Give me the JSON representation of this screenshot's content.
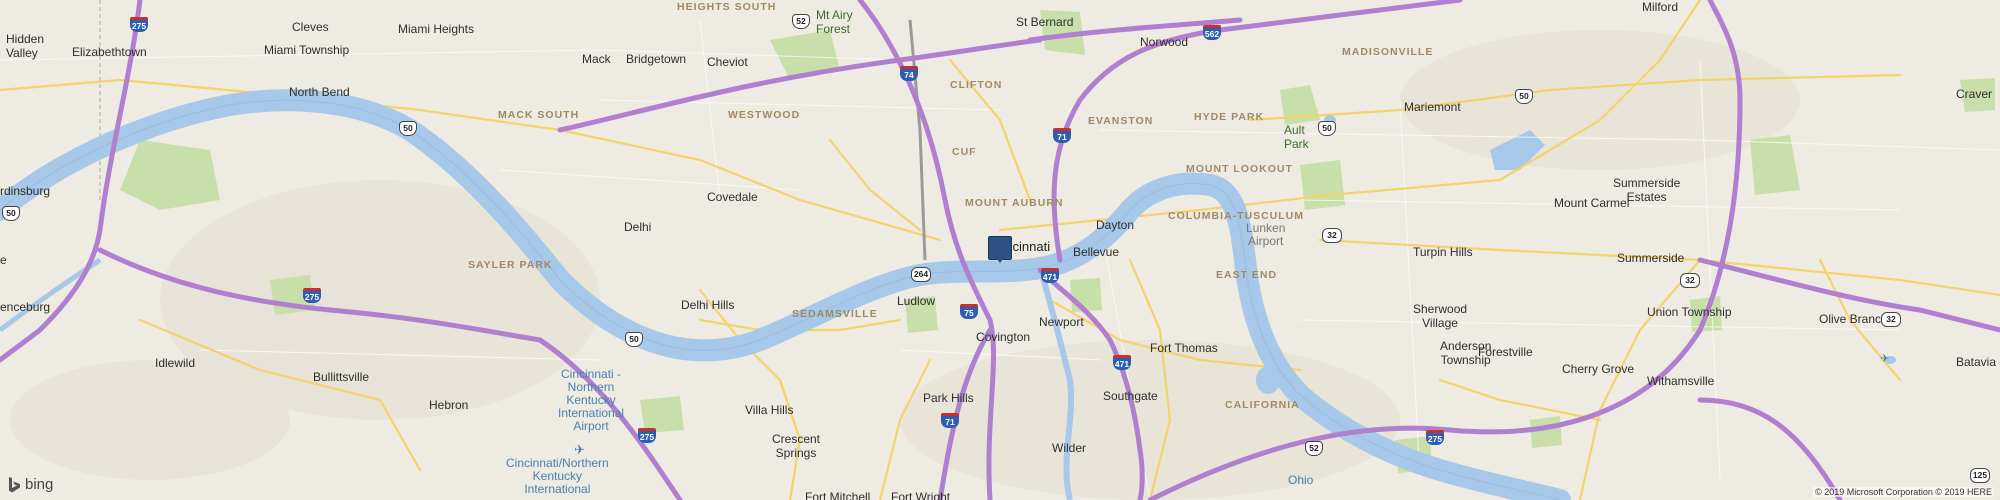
{
  "map": {
    "provider_label": "bing",
    "copyright": "© 2019 Microsoft Corporation © 2019 HERE",
    "colors": {
      "land": "#eeebe2",
      "river": "#a7c8e8",
      "highway": "#b07fcf",
      "arterial": "#f3d36b",
      "park": "#c9dfa9",
      "pin": "#2c5283"
    },
    "marker": {
      "icon": "map-pin-icon",
      "location": "Downtown Cincinnati"
    },
    "towns": [
      {
        "id": "hidden-valley",
        "text": "Hidden\nValley"
      },
      {
        "id": "cleves",
        "text": "Cleves"
      },
      {
        "id": "miami-heights",
        "text": "Miami Heights"
      },
      {
        "id": "elizabethtown",
        "text": "Elizabethtown"
      },
      {
        "id": "miami-township",
        "text": "Miami Township"
      },
      {
        "id": "mack",
        "text": "Mack"
      },
      {
        "id": "bridgetown",
        "text": "Bridgetown"
      },
      {
        "id": "cheviot",
        "text": "Cheviot"
      },
      {
        "id": "mt-airy-forest",
        "text": "Mt Airy\nForest"
      },
      {
        "id": "st-bernard",
        "text": "St Bernard"
      },
      {
        "id": "norwood",
        "text": "Norwood"
      },
      {
        "id": "milford",
        "text": "Milford"
      },
      {
        "id": "north-bend",
        "text": "North Bend"
      },
      {
        "id": "mariemont",
        "text": "Mariemont"
      },
      {
        "id": "craver",
        "text": "Craver"
      },
      {
        "id": "ault-park",
        "text": "Ault\nPark"
      },
      {
        "id": "lawrenceburg",
        "text": "rdinsburg"
      },
      {
        "id": "covedale",
        "text": "Covedale"
      },
      {
        "id": "mount-carmel",
        "text": "Mount Carmel"
      },
      {
        "id": "summerside-estates",
        "text": "Summerside\nEstates"
      },
      {
        "id": "delhi",
        "text": "Delhi"
      },
      {
        "id": "cincinnati",
        "text": "Cincinnati"
      },
      {
        "id": "dayton",
        "text": "Dayton"
      },
      {
        "id": "bellevue",
        "text": "Bellevue"
      },
      {
        "id": "lunken-airport",
        "text": "Lunken\nAirport"
      },
      {
        "id": "turpin-hills",
        "text": "Turpin Hills"
      },
      {
        "id": "summerside",
        "text": "Summerside"
      },
      {
        "id": "delhi-hills",
        "text": "Delhi Hills"
      },
      {
        "id": "ludlow",
        "text": "Ludlow"
      },
      {
        "id": "enceburg",
        "text": "enceburg"
      },
      {
        "id": "covington",
        "text": "Covington"
      },
      {
        "id": "newport",
        "text": "Newport"
      },
      {
        "id": "sherwood-village",
        "text": "Sherwood\nVillage"
      },
      {
        "id": "union-township",
        "text": "Union Township"
      },
      {
        "id": "olive-branch",
        "text": "Olive Branch"
      },
      {
        "id": "fort-thomas",
        "text": "Fort Thomas"
      },
      {
        "id": "anderson-township",
        "text": "Anderson\nTownship"
      },
      {
        "id": "idlewild",
        "text": "Idlewild"
      },
      {
        "id": "bullittsville",
        "text": "Bullittsville"
      },
      {
        "id": "batavia",
        "text": "Batavia"
      },
      {
        "id": "cherry-grove",
        "text": "Cherry Grove"
      },
      {
        "id": "forestville",
        "text": "Forestville"
      },
      {
        "id": "hebron",
        "text": "Hebron"
      },
      {
        "id": "withamsville",
        "text": "Withamsville"
      },
      {
        "id": "park-hills",
        "text": "Park Hills"
      },
      {
        "id": "southgate",
        "text": "Southgate"
      },
      {
        "id": "villa-hills",
        "text": "Villa Hills"
      },
      {
        "id": "crescent-springs",
        "text": "Crescent\nSprings"
      },
      {
        "id": "wilder",
        "text": "Wilder"
      },
      {
        "id": "fort-mitchell",
        "text": "Fort Mitchell"
      },
      {
        "id": "fort-wright",
        "text": "Fort Wright"
      },
      {
        "id": "e-edge",
        "text": "e"
      }
    ],
    "neighborhoods": [
      {
        "id": "heights-south",
        "text": "HEIGHTS SOUTH"
      },
      {
        "id": "madisonville",
        "text": "MADISONVILLE"
      },
      {
        "id": "clifton",
        "text": "CLIFTON"
      },
      {
        "id": "mack-south",
        "text": "MACK SOUTH"
      },
      {
        "id": "westwood",
        "text": "WESTWOOD"
      },
      {
        "id": "evanston",
        "text": "EVANSTON"
      },
      {
        "id": "hyde-park",
        "text": "HYDE PARK"
      },
      {
        "id": "cuf",
        "text": "CUF"
      },
      {
        "id": "mount-lookout",
        "text": "MOUNT LOOKOUT"
      },
      {
        "id": "mount-auburn",
        "text": "MOUNT AUBURN"
      },
      {
        "id": "columbia-tusculum",
        "text": "COLUMBIA-TUSCULUM"
      },
      {
        "id": "sayler-park",
        "text": "SAYLER PARK"
      },
      {
        "id": "east-end",
        "text": "EAST END"
      },
      {
        "id": "sedamsville",
        "text": "SEDAMSVILLE"
      },
      {
        "id": "california",
        "text": "CALIFORNIA"
      }
    ],
    "water": [
      {
        "id": "ohio",
        "text": "Ohio"
      }
    ],
    "airports": [
      {
        "id": "cvg-top",
        "text": "Cincinnati -\nNorthern\nKentucky\nInternational\nAirport"
      },
      {
        "id": "cvg-bottom",
        "text": "Cincinnati/Northern\nKentucky\nInternational"
      }
    ],
    "shields": [
      {
        "id": "i275-nw",
        "type": "i",
        "text": "275"
      },
      {
        "id": "us52-n",
        "type": "us",
        "text": "52"
      },
      {
        "id": "i74",
        "type": "i",
        "text": "74"
      },
      {
        "id": "sr562",
        "type": "i",
        "text": "562"
      },
      {
        "id": "us50-east",
        "type": "us",
        "text": "50"
      },
      {
        "id": "us50-mariemont",
        "type": "us",
        "text": "50"
      },
      {
        "id": "us50-north-bend",
        "type": "us",
        "text": "50"
      },
      {
        "id": "sr50-west",
        "type": "us",
        "text": "50"
      },
      {
        "id": "i71-n",
        "type": "i",
        "text": "71"
      },
      {
        "id": "us32-a",
        "type": "sr",
        "text": "32"
      },
      {
        "id": "us32-b",
        "type": "sr",
        "text": "32"
      },
      {
        "id": "us32-c",
        "type": "sr",
        "text": "32"
      },
      {
        "id": "i264",
        "type": "sr",
        "text": "264"
      },
      {
        "id": "i471",
        "type": "i",
        "text": "471"
      },
      {
        "id": "i75",
        "type": "i",
        "text": "75"
      },
      {
        "id": "i275-sw",
        "type": "i",
        "text": "275"
      },
      {
        "id": "us50-sayler",
        "type": "us",
        "text": "50"
      },
      {
        "id": "i471-s",
        "type": "i",
        "text": "471"
      },
      {
        "id": "i71-s",
        "type": "i",
        "text": "71"
      },
      {
        "id": "i275-airport",
        "type": "i",
        "text": "275"
      },
      {
        "id": "us52-ohio",
        "type": "us",
        "text": "52"
      },
      {
        "id": "i275-se",
        "type": "i",
        "text": "275"
      },
      {
        "id": "i125",
        "type": "sr",
        "text": "125"
      }
    ]
  }
}
